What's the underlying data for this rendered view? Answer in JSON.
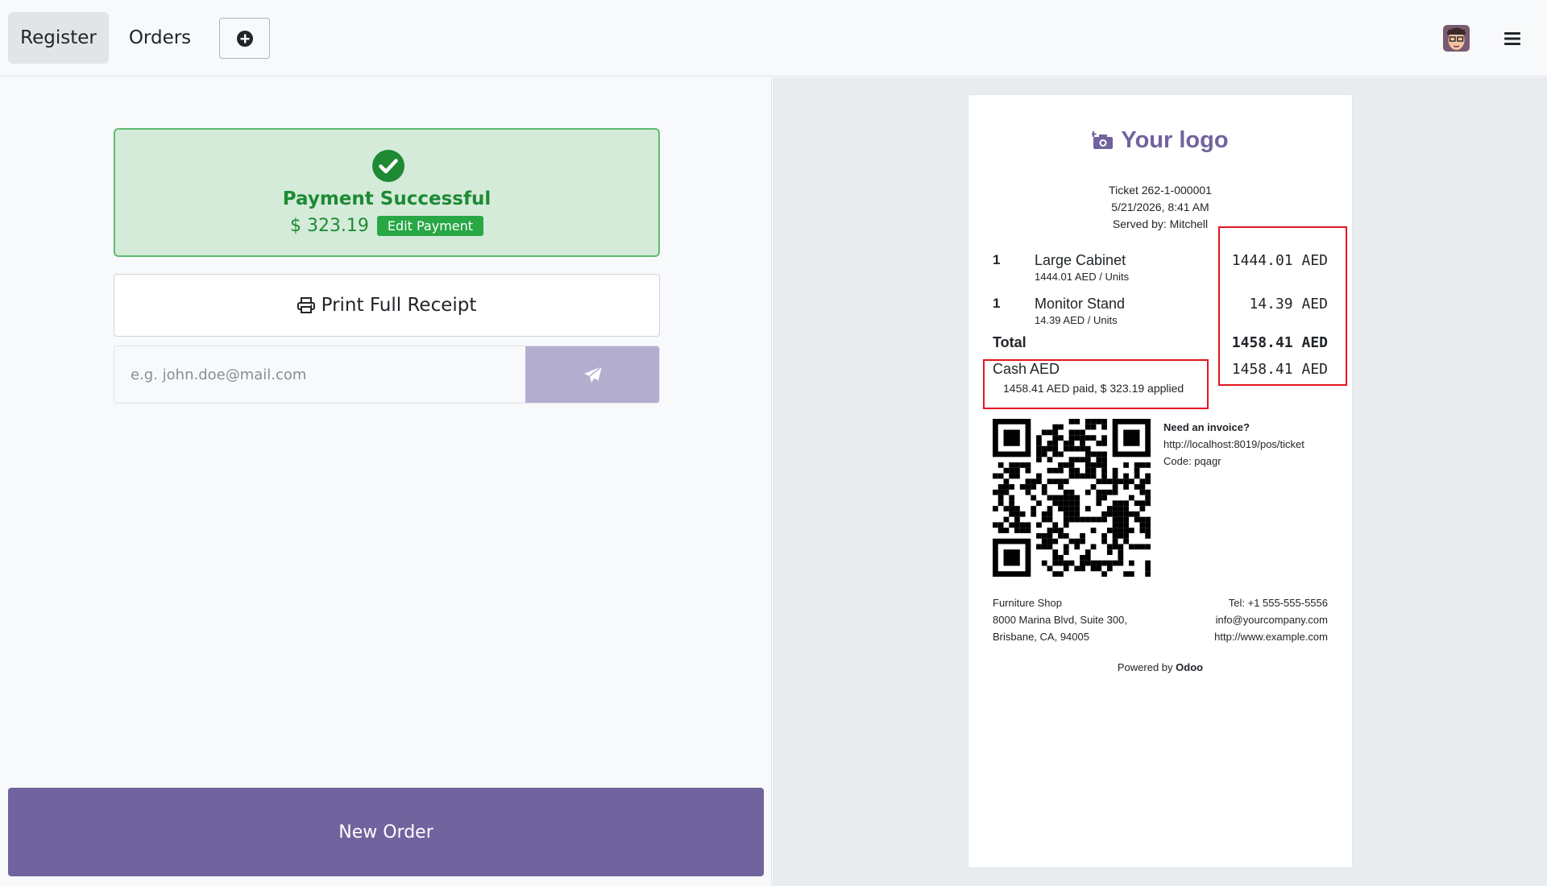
{
  "navbar": {
    "tabs": [
      "Register",
      "Orders"
    ],
    "add_icon": "plus-circle-icon",
    "avatar_icon": "user-avatar",
    "menu_icon": "hamburger-menu-icon"
  },
  "payment": {
    "status_icon": "check-circle-icon",
    "title": "Payment Successful",
    "amount": "$ 323.19",
    "edit_label": "Edit Payment",
    "print_label": "Print Full Receipt",
    "email_placeholder": "e.g. john.doe@mail.com",
    "send_icon": "paper-plane-icon",
    "new_order_label": "New Order"
  },
  "receipt": {
    "logo_text": "Your logo",
    "logo_icon": "camera-plus-icon",
    "ticket": "Ticket 262-1-000001",
    "date": "5/21/2026, 8:41 AM",
    "served_by": "Served by: Mitchell",
    "lines": [
      {
        "qty": "1",
        "name": "Large Cabinet",
        "unit_price": "1444.01 AED / Units",
        "price": "1444.01 AED"
      },
      {
        "qty": "1",
        "name": "Monitor Stand",
        "unit_price": "14.39 AED / Units",
        "price": "14.39 AED"
      }
    ],
    "total_label": "Total",
    "total": "1458.41 AED",
    "payment_method": "Cash AED",
    "payment_amount": "1458.41 AED",
    "payment_detail": "1458.41 AED paid, $ 323.19 applied",
    "invoice_title": "Need an invoice?",
    "invoice_url": "http://localhost:8019/pos/ticket",
    "invoice_code": "Code: pqagr",
    "company_name": "Furniture Shop",
    "company_address1": "8000 Marina Blvd, Suite 300,",
    "company_address2": "Brisbane, CA, 94005",
    "tel": "Tel: +1 555-555-5556",
    "email": "info@yourcompany.com",
    "website": "http://www.example.com",
    "powered_by": "Powered by",
    "powered_brand": "Odoo"
  },
  "colors": {
    "accent": "#71639e",
    "success_bg": "#d4ebd9",
    "success_text": "#1e8a34",
    "highlight": "#e4151f"
  }
}
